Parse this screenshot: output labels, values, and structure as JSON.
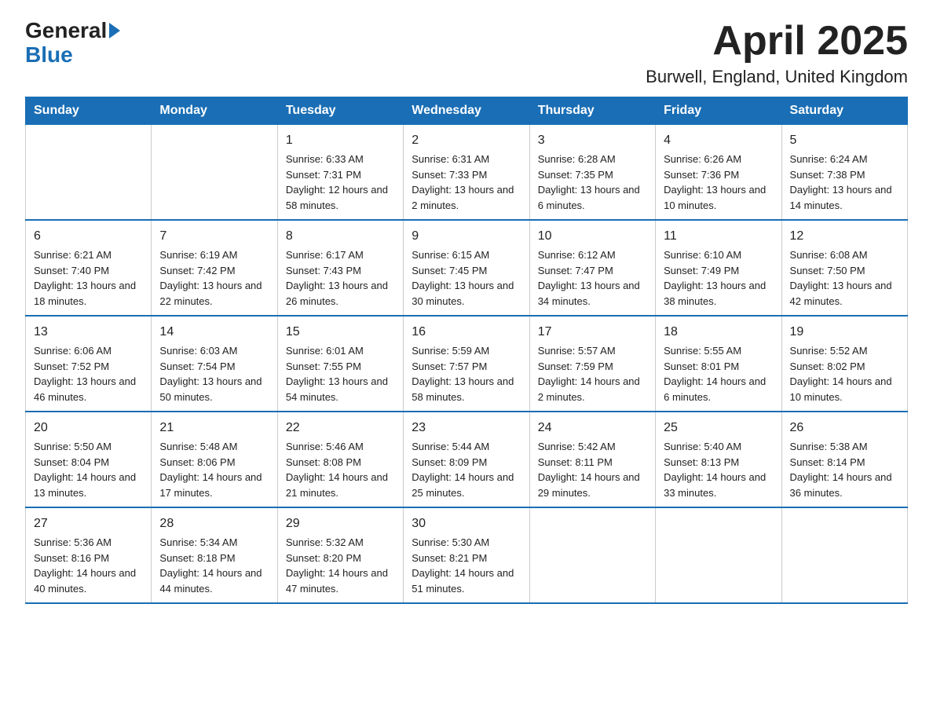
{
  "header": {
    "title": "April 2025",
    "subtitle": "Burwell, England, United Kingdom"
  },
  "logo": {
    "line1": "General",
    "line2": "Blue"
  },
  "days_of_week": [
    "Sunday",
    "Monday",
    "Tuesday",
    "Wednesday",
    "Thursday",
    "Friday",
    "Saturday"
  ],
  "weeks": [
    [
      {
        "day": "",
        "sunrise": "",
        "sunset": "",
        "daylight": ""
      },
      {
        "day": "",
        "sunrise": "",
        "sunset": "",
        "daylight": ""
      },
      {
        "day": "1",
        "sunrise": "Sunrise: 6:33 AM",
        "sunset": "Sunset: 7:31 PM",
        "daylight": "Daylight: 12 hours and 58 minutes."
      },
      {
        "day": "2",
        "sunrise": "Sunrise: 6:31 AM",
        "sunset": "Sunset: 7:33 PM",
        "daylight": "Daylight: 13 hours and 2 minutes."
      },
      {
        "day": "3",
        "sunrise": "Sunrise: 6:28 AM",
        "sunset": "Sunset: 7:35 PM",
        "daylight": "Daylight: 13 hours and 6 minutes."
      },
      {
        "day": "4",
        "sunrise": "Sunrise: 6:26 AM",
        "sunset": "Sunset: 7:36 PM",
        "daylight": "Daylight: 13 hours and 10 minutes."
      },
      {
        "day": "5",
        "sunrise": "Sunrise: 6:24 AM",
        "sunset": "Sunset: 7:38 PM",
        "daylight": "Daylight: 13 hours and 14 minutes."
      }
    ],
    [
      {
        "day": "6",
        "sunrise": "Sunrise: 6:21 AM",
        "sunset": "Sunset: 7:40 PM",
        "daylight": "Daylight: 13 hours and 18 minutes."
      },
      {
        "day": "7",
        "sunrise": "Sunrise: 6:19 AM",
        "sunset": "Sunset: 7:42 PM",
        "daylight": "Daylight: 13 hours and 22 minutes."
      },
      {
        "day": "8",
        "sunrise": "Sunrise: 6:17 AM",
        "sunset": "Sunset: 7:43 PM",
        "daylight": "Daylight: 13 hours and 26 minutes."
      },
      {
        "day": "9",
        "sunrise": "Sunrise: 6:15 AM",
        "sunset": "Sunset: 7:45 PM",
        "daylight": "Daylight: 13 hours and 30 minutes."
      },
      {
        "day": "10",
        "sunrise": "Sunrise: 6:12 AM",
        "sunset": "Sunset: 7:47 PM",
        "daylight": "Daylight: 13 hours and 34 minutes."
      },
      {
        "day": "11",
        "sunrise": "Sunrise: 6:10 AM",
        "sunset": "Sunset: 7:49 PM",
        "daylight": "Daylight: 13 hours and 38 minutes."
      },
      {
        "day": "12",
        "sunrise": "Sunrise: 6:08 AM",
        "sunset": "Sunset: 7:50 PM",
        "daylight": "Daylight: 13 hours and 42 minutes."
      }
    ],
    [
      {
        "day": "13",
        "sunrise": "Sunrise: 6:06 AM",
        "sunset": "Sunset: 7:52 PM",
        "daylight": "Daylight: 13 hours and 46 minutes."
      },
      {
        "day": "14",
        "sunrise": "Sunrise: 6:03 AM",
        "sunset": "Sunset: 7:54 PM",
        "daylight": "Daylight: 13 hours and 50 minutes."
      },
      {
        "day": "15",
        "sunrise": "Sunrise: 6:01 AM",
        "sunset": "Sunset: 7:55 PM",
        "daylight": "Daylight: 13 hours and 54 minutes."
      },
      {
        "day": "16",
        "sunrise": "Sunrise: 5:59 AM",
        "sunset": "Sunset: 7:57 PM",
        "daylight": "Daylight: 13 hours and 58 minutes."
      },
      {
        "day": "17",
        "sunrise": "Sunrise: 5:57 AM",
        "sunset": "Sunset: 7:59 PM",
        "daylight": "Daylight: 14 hours and 2 minutes."
      },
      {
        "day": "18",
        "sunrise": "Sunrise: 5:55 AM",
        "sunset": "Sunset: 8:01 PM",
        "daylight": "Daylight: 14 hours and 6 minutes."
      },
      {
        "day": "19",
        "sunrise": "Sunrise: 5:52 AM",
        "sunset": "Sunset: 8:02 PM",
        "daylight": "Daylight: 14 hours and 10 minutes."
      }
    ],
    [
      {
        "day": "20",
        "sunrise": "Sunrise: 5:50 AM",
        "sunset": "Sunset: 8:04 PM",
        "daylight": "Daylight: 14 hours and 13 minutes."
      },
      {
        "day": "21",
        "sunrise": "Sunrise: 5:48 AM",
        "sunset": "Sunset: 8:06 PM",
        "daylight": "Daylight: 14 hours and 17 minutes."
      },
      {
        "day": "22",
        "sunrise": "Sunrise: 5:46 AM",
        "sunset": "Sunset: 8:08 PM",
        "daylight": "Daylight: 14 hours and 21 minutes."
      },
      {
        "day": "23",
        "sunrise": "Sunrise: 5:44 AM",
        "sunset": "Sunset: 8:09 PM",
        "daylight": "Daylight: 14 hours and 25 minutes."
      },
      {
        "day": "24",
        "sunrise": "Sunrise: 5:42 AM",
        "sunset": "Sunset: 8:11 PM",
        "daylight": "Daylight: 14 hours and 29 minutes."
      },
      {
        "day": "25",
        "sunrise": "Sunrise: 5:40 AM",
        "sunset": "Sunset: 8:13 PM",
        "daylight": "Daylight: 14 hours and 33 minutes."
      },
      {
        "day": "26",
        "sunrise": "Sunrise: 5:38 AM",
        "sunset": "Sunset: 8:14 PM",
        "daylight": "Daylight: 14 hours and 36 minutes."
      }
    ],
    [
      {
        "day": "27",
        "sunrise": "Sunrise: 5:36 AM",
        "sunset": "Sunset: 8:16 PM",
        "daylight": "Daylight: 14 hours and 40 minutes."
      },
      {
        "day": "28",
        "sunrise": "Sunrise: 5:34 AM",
        "sunset": "Sunset: 8:18 PM",
        "daylight": "Daylight: 14 hours and 44 minutes."
      },
      {
        "day": "29",
        "sunrise": "Sunrise: 5:32 AM",
        "sunset": "Sunset: 8:20 PM",
        "daylight": "Daylight: 14 hours and 47 minutes."
      },
      {
        "day": "30",
        "sunrise": "Sunrise: 5:30 AM",
        "sunset": "Sunset: 8:21 PM",
        "daylight": "Daylight: 14 hours and 51 minutes."
      },
      {
        "day": "",
        "sunrise": "",
        "sunset": "",
        "daylight": ""
      },
      {
        "day": "",
        "sunrise": "",
        "sunset": "",
        "daylight": ""
      },
      {
        "day": "",
        "sunrise": "",
        "sunset": "",
        "daylight": ""
      }
    ]
  ]
}
